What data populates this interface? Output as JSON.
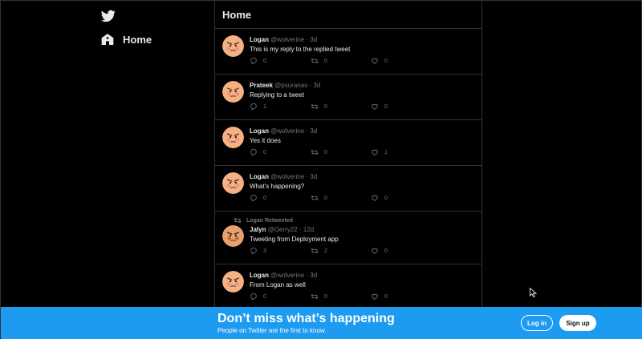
{
  "nav": {
    "home_label": "Home"
  },
  "timeline": {
    "title": "Home",
    "tweets": [
      {
        "name": "Logan",
        "handle": "@wolverine",
        "time": "3d",
        "text": "This is my reply to the replied tweet",
        "replies": "0",
        "retweets": "0",
        "likes": "0",
        "avatar": "logan",
        "retweeted_by": ""
      },
      {
        "name": "Prateek",
        "handle": "@psuranas",
        "time": "3d",
        "text": "Replying to a tweet",
        "replies": "1",
        "retweets": "0",
        "likes": "0",
        "avatar": "prateek",
        "retweeted_by": ""
      },
      {
        "name": "Logan",
        "handle": "@wolverine",
        "time": "3d",
        "text": "Yes it does",
        "replies": "0",
        "retweets": "0",
        "likes": "1",
        "avatar": "logan",
        "retweeted_by": ""
      },
      {
        "name": "Logan",
        "handle": "@wolverine",
        "time": "3d",
        "text": "What's happening?",
        "replies": "0",
        "retweets": "0",
        "likes": "0",
        "avatar": "logan",
        "retweeted_by": ""
      },
      {
        "name": "Jalyn",
        "handle": "@Gerry22",
        "time": "12d",
        "text": "Tweeting from Deployment app",
        "replies": "3",
        "retweets": "2",
        "likes": "0",
        "avatar": "jalyn",
        "retweeted_by": "Logan Retweeted"
      },
      {
        "name": "Logan",
        "handle": "@wolverine",
        "time": "3d",
        "text": "From Logan as well",
        "replies": "0",
        "retweets": "0",
        "likes": "0",
        "avatar": "logan",
        "retweeted_by": ""
      }
    ],
    "separator": "·"
  },
  "bottom_bar": {
    "title": "Don’t miss what’s happening",
    "subtitle": "People on Twitter are the first to know.",
    "login_label": "Log in",
    "signup_label": "Sign up"
  },
  "colors": {
    "accent": "#1d9bf0",
    "background": "#000000",
    "muted": "#71767b"
  },
  "icons": {
    "logo": "twitter-bird-icon",
    "home": "home-icon",
    "reply": "reply-icon",
    "retweet": "retweet-icon",
    "like": "heart-icon"
  }
}
